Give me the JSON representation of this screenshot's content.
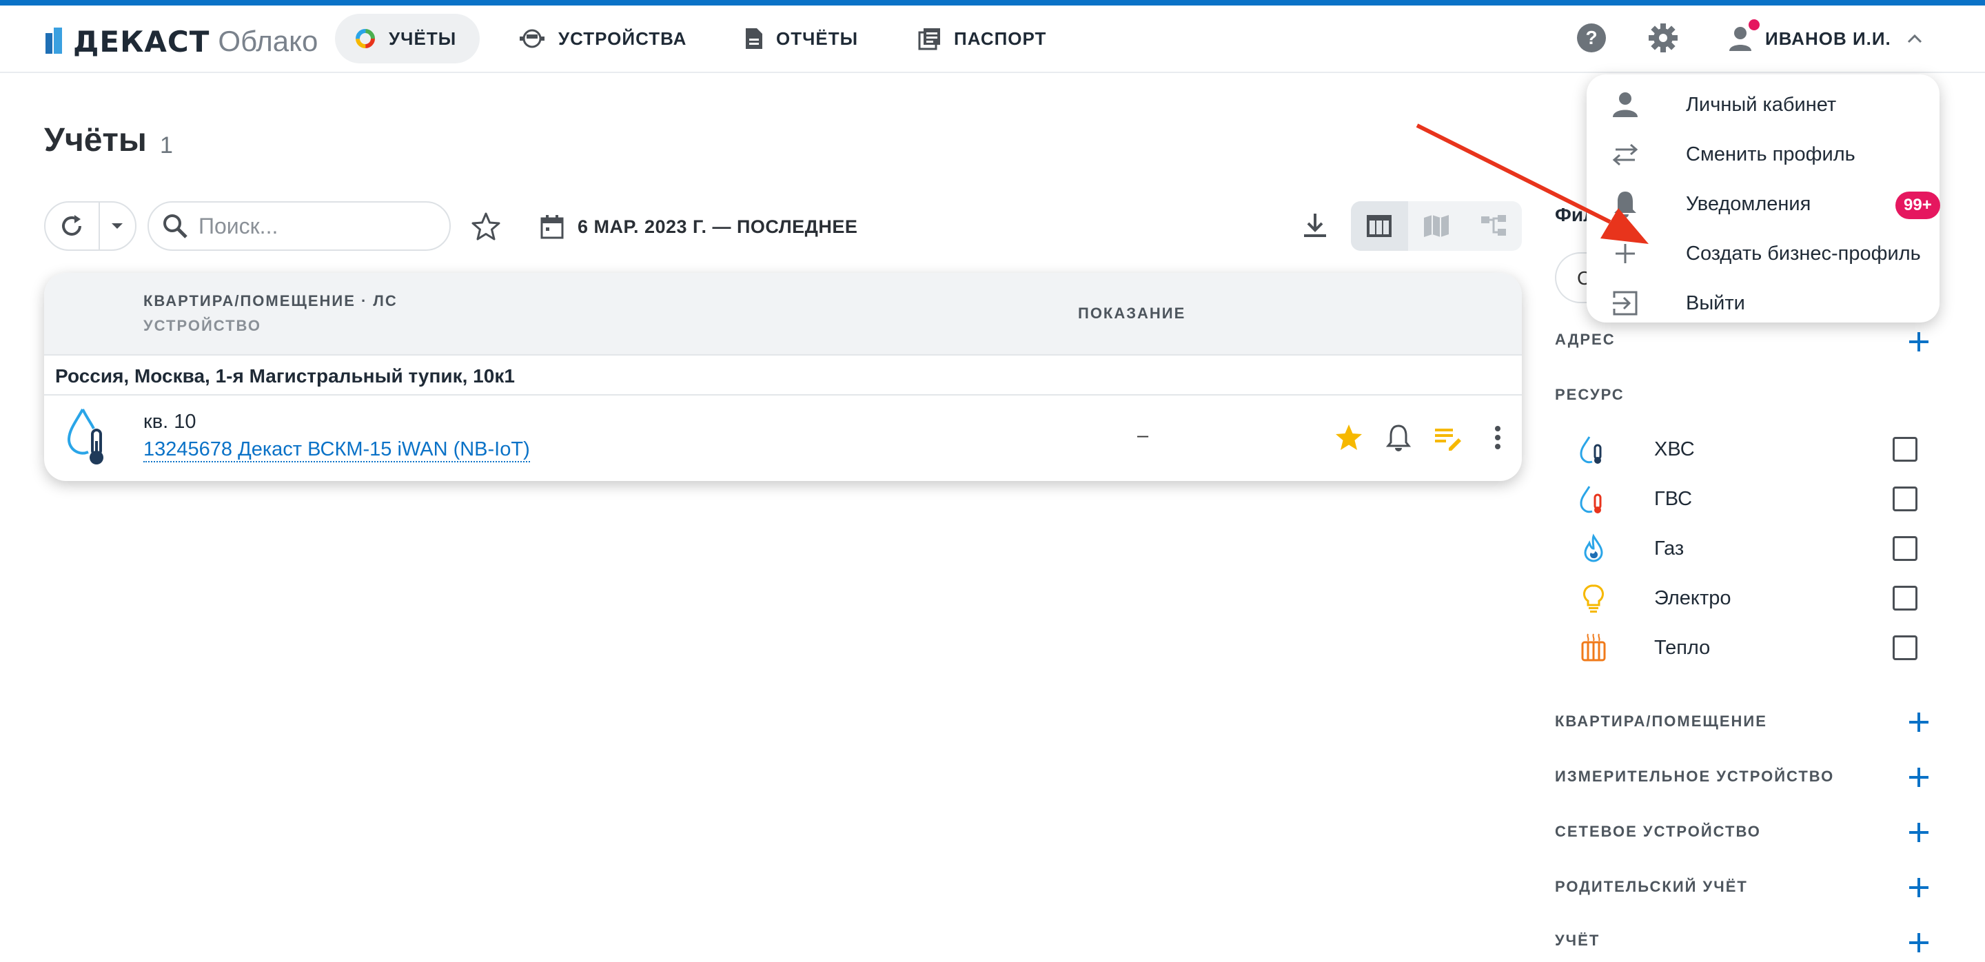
{
  "header": {
    "brand": "ДЕКАСТ",
    "brand_sub": "Облако",
    "nav": [
      {
        "label": "УЧЁТЫ",
        "icon": "donut-chart-icon",
        "active": true
      },
      {
        "label": "УСТРОЙСТВА",
        "icon": "meter-device-icon",
        "active": false
      },
      {
        "label": "ОТЧЁТЫ",
        "icon": "document-icon",
        "active": false
      },
      {
        "label": "ПАСПОРТ",
        "icon": "passport-book-icon",
        "active": false
      }
    ],
    "user_name": "ИВАНОВ И.И."
  },
  "page": {
    "title": "Учёты",
    "count": "1"
  },
  "toolbar": {
    "search_placeholder": "Поиск...",
    "date_range": "6 МАР. 2023 Г. — ПОСЛЕДНЕЕ"
  },
  "table": {
    "col1_line1": "КВАРТИРА/ПОМЕЩЕНИЕ · ЛС",
    "col1_line2": "УСТРОЙСТВО",
    "col2": "ПОКАЗАНИЕ",
    "group_address": "Россия, Москва, 1-я Магистральный тупик, 10к1",
    "rows": [
      {
        "apartment": "кв. 10",
        "device": "13245678 Декаст ВСКМ-15 iWAN (NB-IoT)",
        "reading": "–",
        "favorite": true
      }
    ]
  },
  "filters": {
    "title": "Фил",
    "chip_text": "С",
    "sections": {
      "address": "АДРЕС",
      "resource": "РЕСУРС",
      "apartment": "КВАРТИРА/ПОМЕЩЕНИЕ",
      "meter": "ИЗМЕРИТЕЛЬНОЕ УСТРОЙСТВО",
      "network": "СЕТЕВОЕ УСТРОЙСТВО",
      "parent": "РОДИТЕЛЬСКИЙ УЧЁТ",
      "account": "УЧЁТ"
    },
    "resources": [
      {
        "label": "ХВС",
        "icon": "cold-water-icon",
        "checked": false
      },
      {
        "label": "ГВС",
        "icon": "hot-water-icon",
        "checked": false
      },
      {
        "label": "Газ",
        "icon": "gas-flame-icon",
        "checked": false
      },
      {
        "label": "Электро",
        "icon": "light-bulb-icon",
        "checked": false
      },
      {
        "label": "Тепло",
        "icon": "radiator-icon",
        "checked": false
      }
    ]
  },
  "user_menu": {
    "items": [
      {
        "label": "Личный кабинет",
        "icon": "person-icon"
      },
      {
        "label": "Сменить профиль",
        "icon": "swap-arrows-icon"
      },
      {
        "label": "Уведомления",
        "icon": "bell-icon",
        "badge": "99+"
      },
      {
        "label": "Создать бизнес-профиль",
        "icon": "plus-icon"
      },
      {
        "label": "Выйти",
        "icon": "logout-icon"
      }
    ]
  },
  "colors": {
    "accent": "#0a72c7",
    "badge": "#e5175f",
    "star": "#f6b800",
    "annotation_arrow": "#e8341c"
  }
}
